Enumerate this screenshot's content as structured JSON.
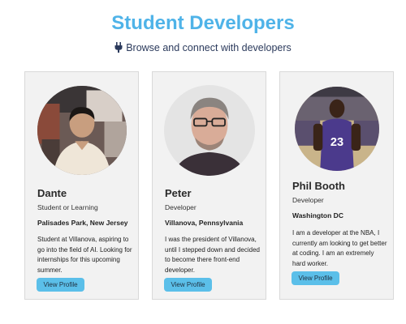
{
  "header": {
    "title": "Student Developers",
    "subtitle": "Browse and connect with developers",
    "subtitle_icon": "plug-icon"
  },
  "colors": {
    "title": "#4fb3e8",
    "button": "#5bbfe9",
    "card_bg": "#f2f2f2"
  },
  "cards": [
    {
      "name": "Dante",
      "role": "Student or Learning",
      "location": "Palisades Park, New Jersey",
      "bio": "Student at Villanova, aspiring to go into the field of AI. Looking for internships for this upcoming summer.",
      "button_label": "View Profile"
    },
    {
      "name": "Peter",
      "role": "Developer",
      "location": "Villanova, Pennsylvania",
      "bio": "I was the president of Villanova, until I stepped down and decided to become there front-end developer.",
      "button_label": "View Profile"
    },
    {
      "name": "Phil Booth",
      "role": "Developer",
      "location": "Washington DC",
      "bio": "I am a developer at the NBA, I currently am looking to get better at coding. I am an extremely hard worker.",
      "button_label": "View Profile"
    }
  ]
}
